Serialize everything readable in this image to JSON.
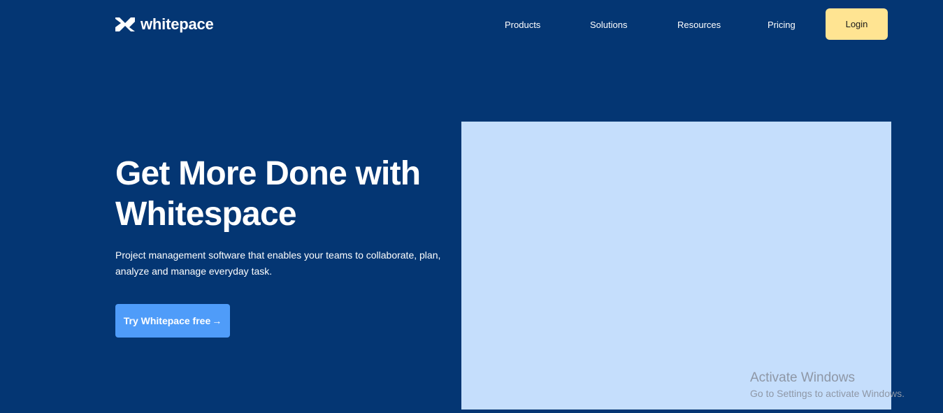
{
  "brand": {
    "name": "whitepace",
    "icon": "whitepace-logo-icon"
  },
  "nav": {
    "items": [
      "Products",
      "Solutions",
      "Resources",
      "Pricing"
    ],
    "login_label": "Login"
  },
  "hero": {
    "title": "Get More Done with Whitespace",
    "subtitle": "Project management software that enables your teams to collaborate, plan, analyze and manage everyday task.",
    "cta_label": "Try Whitepace free",
    "cta_arrow": "→"
  },
  "watermark": {
    "title": "Activate Windows",
    "subtitle": "Go to Settings to activate Windows."
  },
  "colors": {
    "background": "#043673",
    "login_button": "#ffe492",
    "cta_button": "#4f9cf9",
    "hero_image_placeholder": "#c5defc"
  }
}
